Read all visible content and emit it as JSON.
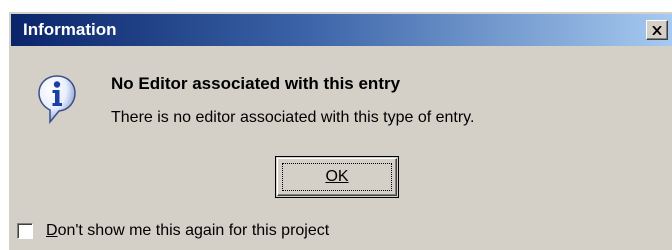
{
  "window": {
    "title": "Information",
    "close_icon": "close-icon"
  },
  "content": {
    "icon": "information-icon",
    "heading": "No Editor associated with this entry",
    "message": "There is no editor associated with this type of entry."
  },
  "buttons": {
    "ok_label": "OK"
  },
  "checkbox": {
    "label_first_letter": "D",
    "label_rest": "on't show me this again for this project",
    "checked": false
  },
  "colors": {
    "titlebar_start": "#0a246a",
    "titlebar_end": "#a6caf0",
    "dialog_face": "#d4d0c8"
  }
}
